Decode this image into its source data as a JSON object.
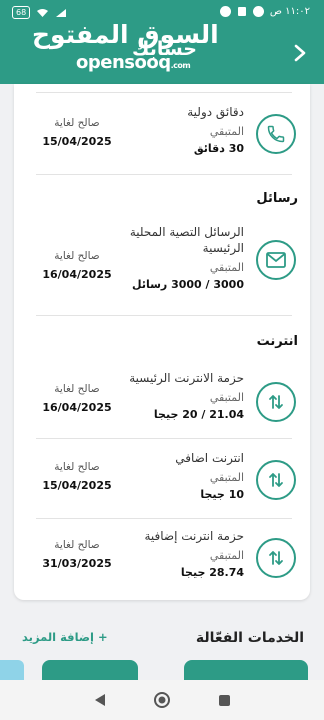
{
  "status_bar": {
    "time": "١١:٠٢ ص",
    "battery": "68"
  },
  "header": {
    "logo_arabic": "السوق المفتوح",
    "logo_english": "opensooq",
    "logo_suffix": ".com",
    "title": "حسابك"
  },
  "top_row": {
    "title": "دقائق دولية",
    "remaining_label": "المتبقي",
    "remaining_value": "30 دقائق",
    "valid_label": "صالح لغاية",
    "valid_date": "15/04/2025",
    "icon": "phone-icon"
  },
  "sections": {
    "messages_title": "رسائل",
    "internet_title": "انترنت"
  },
  "messages_row": {
    "title_line1": "الرسائل التصية المحلية",
    "title_line2": "الرئيسية",
    "remaining_label": "المتبقي",
    "remaining_value": "3000 / 3000 رسائل",
    "valid_label": "صالح لغاية",
    "valid_date": "16/04/2025",
    "icon": "mail-icon"
  },
  "internet_rows": [
    {
      "title": "حزمة الانترنت الرئيسية",
      "remaining_label": "المتبقي",
      "remaining_value": "21.04 / 20 جيجا",
      "valid_label": "صالح لغاية",
      "valid_date": "16/04/2025",
      "icon": "data-transfer-icon"
    },
    {
      "title": "انترنت اضافي",
      "remaining_label": "المتبقي",
      "remaining_value": "10 جيجا",
      "valid_label": "صالح لغاية",
      "valid_date": "15/04/2025",
      "icon": "data-transfer-icon"
    },
    {
      "title": "حزمة انترنت إضافية",
      "remaining_label": "المتبقي",
      "remaining_value": "28.74 جيجا",
      "valid_label": "صالح لغاية",
      "valid_date": "31/03/2025",
      "icon": "data-transfer-icon"
    }
  ],
  "active_services": {
    "title": "الخدمات الفعّالة",
    "add_more": "+ إضافة المزيد"
  },
  "colors": {
    "primary": "#2d9b86",
    "tile_light": "#8fd3e8",
    "background": "#f0f1f3"
  }
}
